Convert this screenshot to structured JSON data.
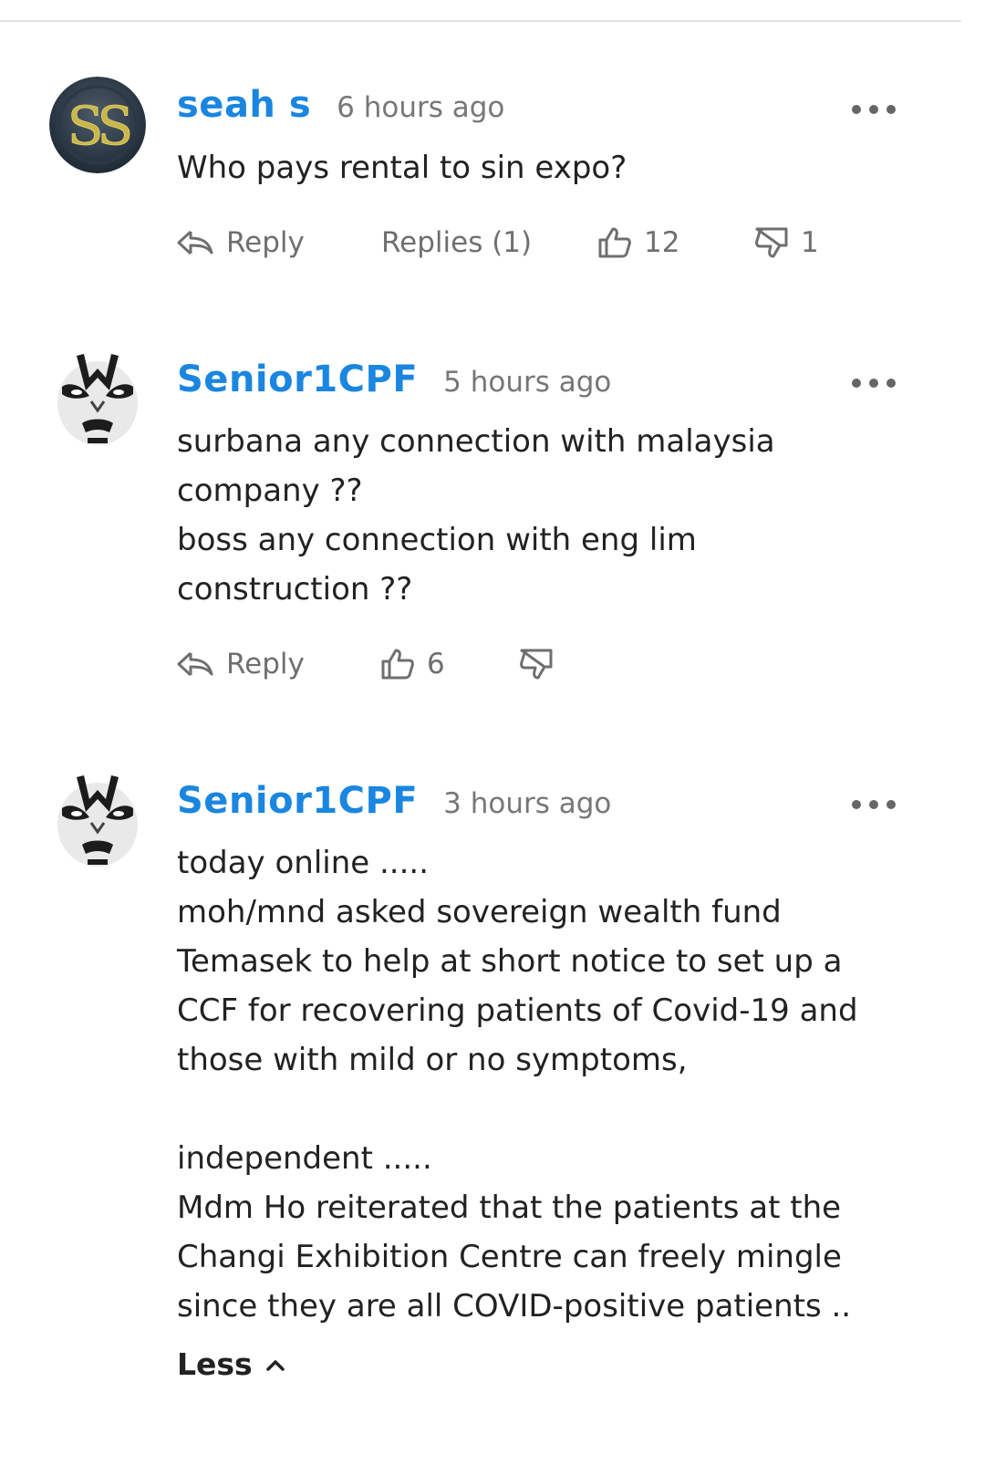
{
  "comments": [
    {
      "username": "seah s",
      "time": "6 hours ago",
      "avatar": "ss-logo-avatar",
      "lines": [
        "Who pays rental to sin expo?"
      ],
      "reply_label": "Reply",
      "replies_label": "Replies (1)",
      "likes": "12",
      "dislikes": "1"
    },
    {
      "username": "Senior1CPF",
      "time": "5 hours ago",
      "avatar": "opera-mask-avatar",
      "lines": [
        "surbana any connection with malaysia",
        "company ??",
        "boss any connection with eng lim",
        "construction ??"
      ],
      "reply_label": "Reply",
      "likes": "6",
      "dislikes": ""
    },
    {
      "username": "Senior1CPF",
      "time": "3 hours ago",
      "avatar": "opera-mask-avatar",
      "lines": [
        "today online .....",
        "moh/mnd asked sovereign wealth fund",
        "Temasek to help at short notice to set up a",
        "CCF for recovering patients of Covid-19 and",
        "those with mild or no symptoms,",
        "",
        "independent .....",
        "Mdm Ho reiterated that the patients at the",
        "Changi Exhibition Centre can freely mingle",
        "since they are all COVID-positive patients .."
      ],
      "less_label": "Less"
    }
  ],
  "colors": {
    "username": "#1a86e0",
    "meta": "#777777",
    "text": "#222222"
  },
  "icons": [
    "reply-icon",
    "thumbs-up-icon",
    "thumbs-down-icon",
    "more-icon",
    "chevron-up-icon"
  ]
}
